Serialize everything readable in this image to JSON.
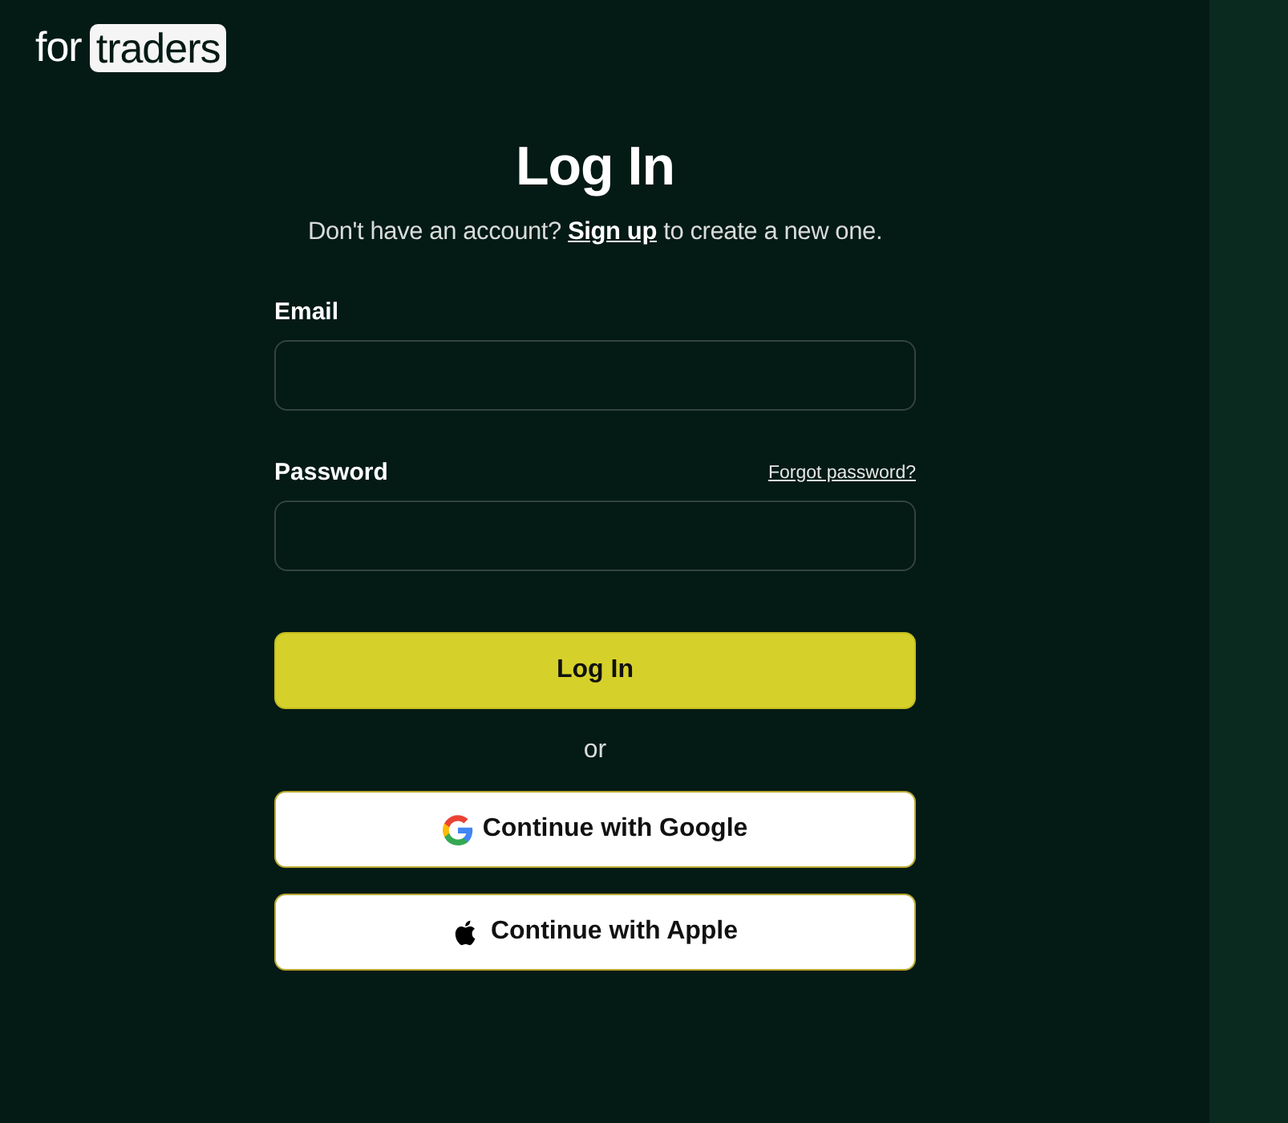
{
  "logo": {
    "word": "for",
    "badge": "traders"
  },
  "title": "Log In",
  "subtitle": {
    "before": "Don't have an account?",
    "link": "Sign up",
    "after": "to create a new one."
  },
  "fields": [
    {
      "label": "Email"
    },
    {
      "label": "Password",
      "link": "Forgot password?"
    }
  ],
  "submit": "Log In",
  "divider": "or",
  "social": [
    {
      "kind": "google",
      "label": "Continue with Google"
    },
    {
      "kind": "apple",
      "label": "Continue with Apple"
    }
  ]
}
